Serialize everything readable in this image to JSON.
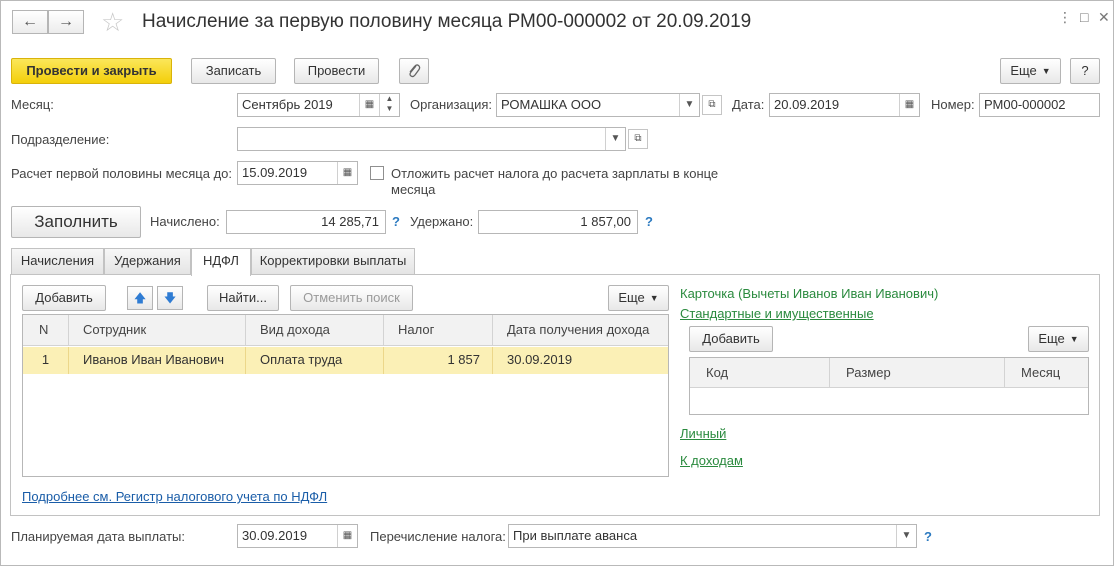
{
  "title": "Начисление за первую половину месяца РМ00-000002 от 20.09.2019",
  "toolbar": {
    "post_close": "Провести и закрыть",
    "save": "Записать",
    "post": "Провести",
    "more": "Еще",
    "help": "?"
  },
  "fields": {
    "month_label": "Месяц:",
    "month_value": "Сентябрь 2019",
    "org_label": "Организация:",
    "org_value": "РОМАШКА ООО",
    "date_label": "Дата:",
    "date_value": "20.09.2019",
    "number_label": "Номер:",
    "number_value": "РМ00-000002",
    "dept_label": "Подразделение:",
    "dept_value": "",
    "calc_label": "Расчет первой половины месяца до:",
    "calc_value": "15.09.2019",
    "defer_label_1": "Отложить расчет налога до расчета зарплаты в конце",
    "defer_label_2": "месяца",
    "defer_checked": false
  },
  "fill_button": "Заполнить",
  "totals": {
    "accrued_label": "Начислено:",
    "accrued_value": "14 285,71",
    "withheld_label": "Удержано:",
    "withheld_value": "1 857,00",
    "help": "?"
  },
  "tabs": [
    {
      "label": "Начисления"
    },
    {
      "label": "Удержания"
    },
    {
      "label": "НДФЛ"
    },
    {
      "label": "Корректировки выплаты"
    }
  ],
  "active_tab": "НДФЛ",
  "ndfl": {
    "add": "Добавить",
    "find": "Найти...",
    "cancel_search": "Отменить поиск",
    "more": "Еще",
    "columns": [
      "N",
      "Сотрудник",
      "Вид дохода",
      "Налог",
      "Дата получения дохода"
    ],
    "rows": [
      {
        "n": "1",
        "employee": "Иванов Иван Иванович",
        "income_type": "Оплата труда",
        "tax": "1 857",
        "date": "30.09.2019"
      }
    ],
    "details_link": "Подробнее см. Регистр налогового учета по НДФЛ"
  },
  "card": {
    "title": "Карточка (Вычеты Иванов Иван Иванович)",
    "standard_link": "Стандартные и имущественные",
    "add": "Добавить",
    "more": "Еще",
    "columns": [
      "Код",
      "Размер",
      "Месяц"
    ],
    "personal_link": "Личный",
    "income_link": "К доходам"
  },
  "footer": {
    "pay_date_label": "Планируемая дата выплаты:",
    "pay_date_value": "30.09.2019",
    "transfer_label": "Перечисление налога:",
    "transfer_value": "При выплате аванса",
    "help": "?"
  }
}
